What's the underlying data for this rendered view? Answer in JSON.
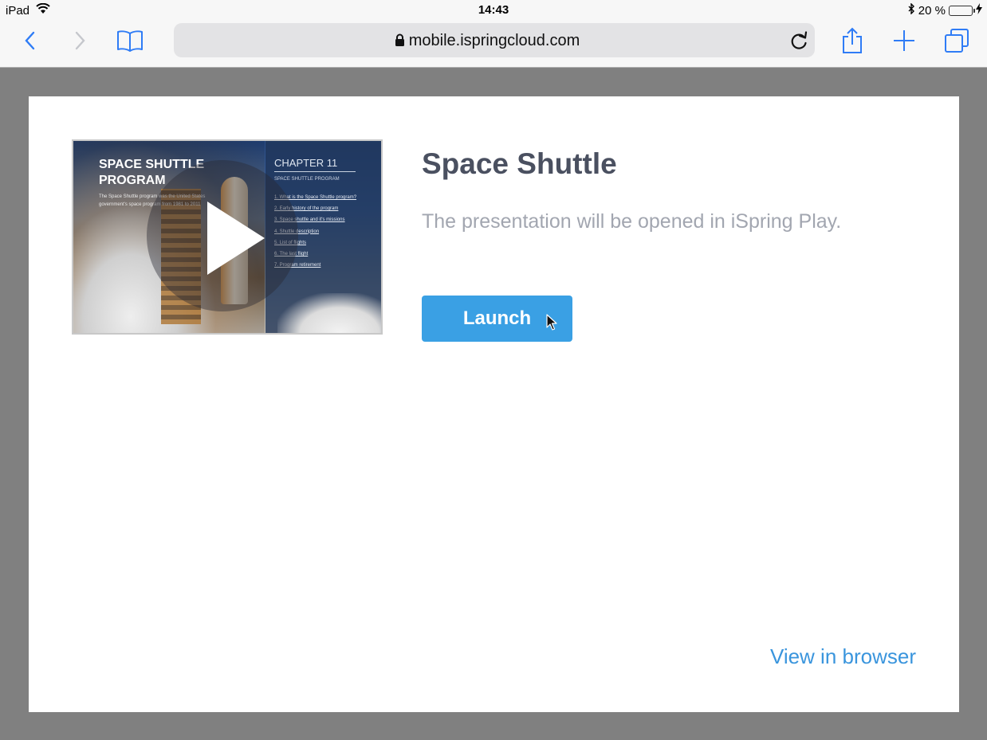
{
  "status_bar": {
    "device": "iPad",
    "time": "14:43",
    "battery": "20 %"
  },
  "browser": {
    "url": "mobile.ispringcloud.com"
  },
  "presentation": {
    "title": "Space Shuttle",
    "description": "The presentation will be opened in iSpring Play.",
    "launch_label": "Launch",
    "view_in_browser_label": "View in browser",
    "thumbnail": {
      "slide_title": "SPACE SHUTTLE PROGRAM",
      "slide_subtitle": "The Space Shuttle program was the United States government's space program from 1981 to 2011",
      "chapter": "CHAPTER 11",
      "chapter_subtitle": "SPACE SHUTTLE PROGRAM",
      "toc": [
        "1. What is the Space Shuttle program?",
        "2. Early history of the program",
        "3. Space shuttle and it's missions",
        "4. Shuttle description",
        "5. List of flights",
        "6. The last flight",
        "7. Program retirement"
      ]
    }
  },
  "colors": {
    "accent": "#3aa0e4",
    "link": "#3a95dd",
    "ios_blue": "#2f7cf6"
  }
}
